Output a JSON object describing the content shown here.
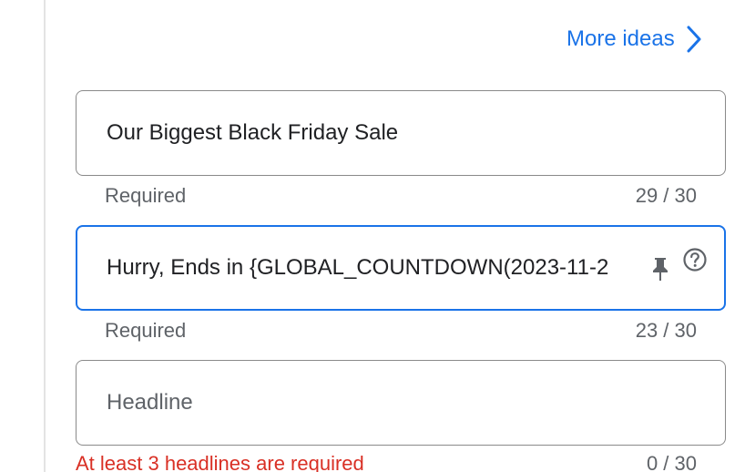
{
  "more_ideas": {
    "label": "More ideas",
    "icon": "chevron-right-icon",
    "color": "#1a73e8"
  },
  "headlines": [
    {
      "value": "Our Biggest Black Friday Sale",
      "placeholder": "",
      "helper": "Required",
      "counter": "29 / 30",
      "focused": false
    },
    {
      "value": "Hurry, Ends in {GLOBAL_COUNTDOWN(2023-11-2",
      "placeholder": "",
      "helper": "Required",
      "counter": "23 / 30",
      "focused": true,
      "icons": [
        "pin-icon",
        "help-icon"
      ]
    },
    {
      "value": "",
      "placeholder": "Headline",
      "helper": "At least 3 headlines are required",
      "counter": "0 / 30",
      "focused": false
    }
  ],
  "colors": {
    "focus_border": "#1a73e8",
    "error": "#d93025",
    "helper": "#5f6368"
  }
}
